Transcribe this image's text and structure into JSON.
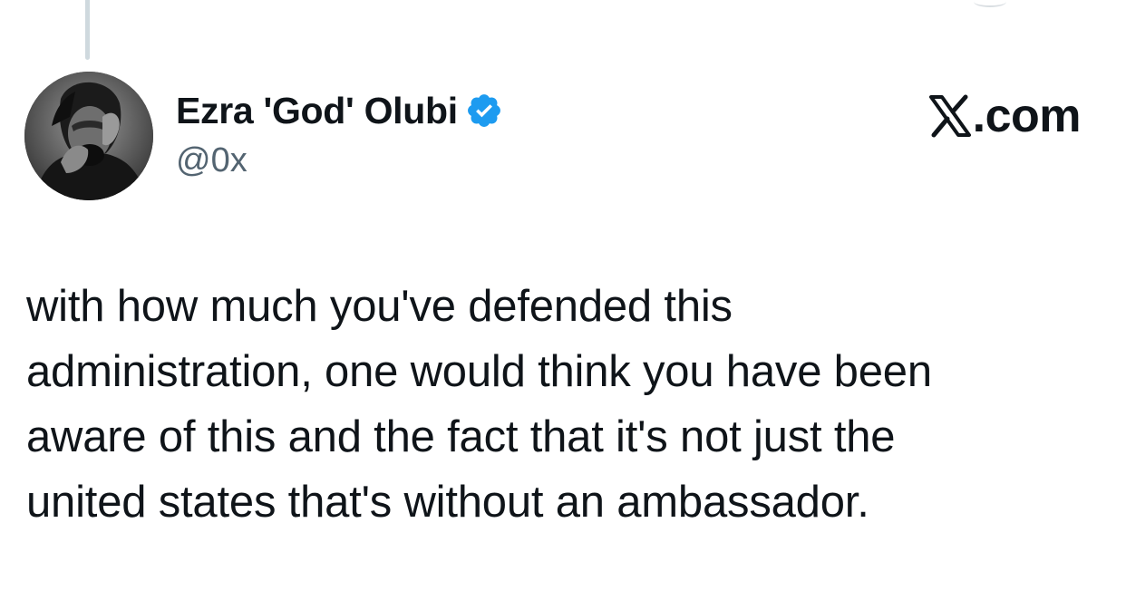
{
  "tweet": {
    "display_name": "Ezra 'God' Olubi",
    "handle": "@0x",
    "text": "with how much you've defended this\nadministration, one would think you have been\naware of this and the fact that it's not just the\nunited states that's without an ambassador."
  },
  "brand": {
    "label": ".com"
  },
  "icons": {
    "verified": "verified-badge-icon",
    "brand": "x-logo-icon"
  },
  "colors": {
    "verified": "#1d9bf0",
    "text": "#0f1419",
    "secondary": "#536471",
    "thread_line": "#cfd9de"
  }
}
